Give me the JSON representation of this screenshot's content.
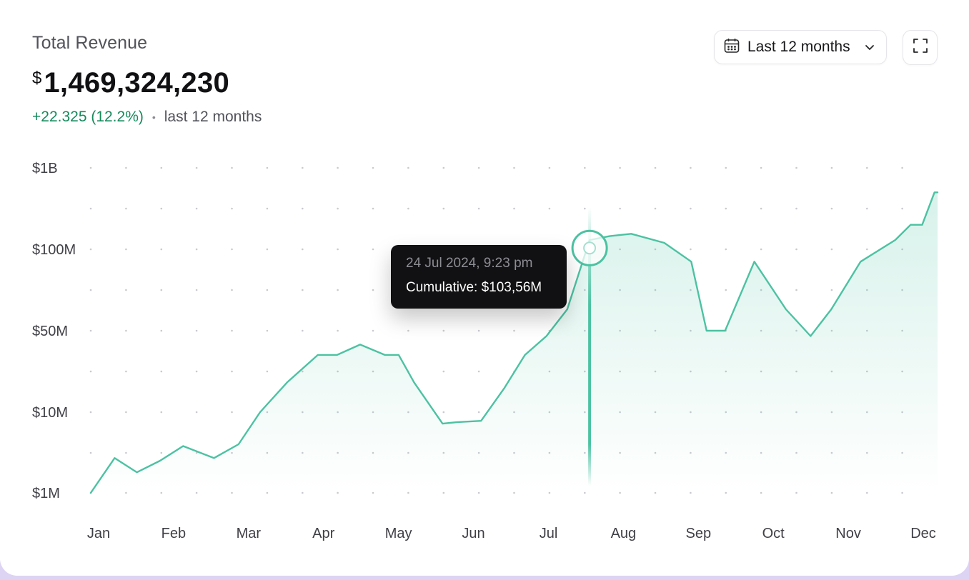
{
  "header": {
    "title": "Total Revenue",
    "currency_symbol": "$",
    "amount": "1,469,324,230",
    "delta": "+22.325 (12.2%)",
    "period": "last 12 months"
  },
  "controls": {
    "range_label": "Last 12 months",
    "range_icon": "calendar-icon",
    "dropdown_icon": "chevron-down-icon",
    "expand_icon": "expand-icon"
  },
  "tooltip": {
    "date": "24 Jul 2024, 9:23 pm",
    "value": "Cumulative: $103,56M"
  },
  "colors": {
    "line": "#4cc2a2",
    "delta": "#168a5c",
    "tooltip_bg": "#111113"
  },
  "chart_data": {
    "type": "area",
    "scale": "log",
    "grid": "dotted",
    "x_tick_labels": [
      "Jan",
      "Feb",
      "Mar",
      "Apr",
      "May",
      "Jun",
      "Jul",
      "Aug",
      "Sep",
      "Oct",
      "Nov",
      "Dec"
    ],
    "y_tick_labels": [
      "$1B",
      "$100M",
      "$50M",
      "$10M",
      "$1M"
    ],
    "y_tick_values": [
      1000000000,
      100000000,
      50000000,
      10000000,
      1000000
    ],
    "xlim": [
      0,
      11
    ],
    "x": [
      0,
      0.31,
      0.6,
      0.9,
      1.2,
      1.6,
      1.92,
      2.2,
      2.55,
      2.95,
      3.2,
      3.5,
      3.82,
      4.0,
      4.2,
      4.57,
      4.75,
      5.07,
      5.37,
      5.64,
      5.92,
      6.19,
      6.48,
      6.74,
      7.02,
      7.45,
      7.8,
      8.0,
      8.24,
      8.62,
      9.03,
      9.35,
      9.62,
      10.0,
      10.45,
      10.65,
      10.8,
      10.96,
      11.0
    ],
    "y": [
      1000000,
      2700000,
      1800000,
      2500000,
      3800000,
      2700000,
      4000000,
      10000000,
      18000000,
      31000000,
      31000000,
      38000000,
      31000000,
      31000000,
      18000000,
      7200000,
      7500000,
      7800000,
      16000000,
      31000000,
      45000000,
      60000000,
      130000000,
      145000000,
      155000000,
      120000000,
      90000000,
      50000000,
      50000000,
      90000000,
      60000000,
      45000000,
      60000000,
      90000000,
      130000000,
      200000000,
      200000000,
      500000000,
      500000000
    ],
    "highlight": {
      "x": 6.48,
      "y": 103560000
    }
  }
}
